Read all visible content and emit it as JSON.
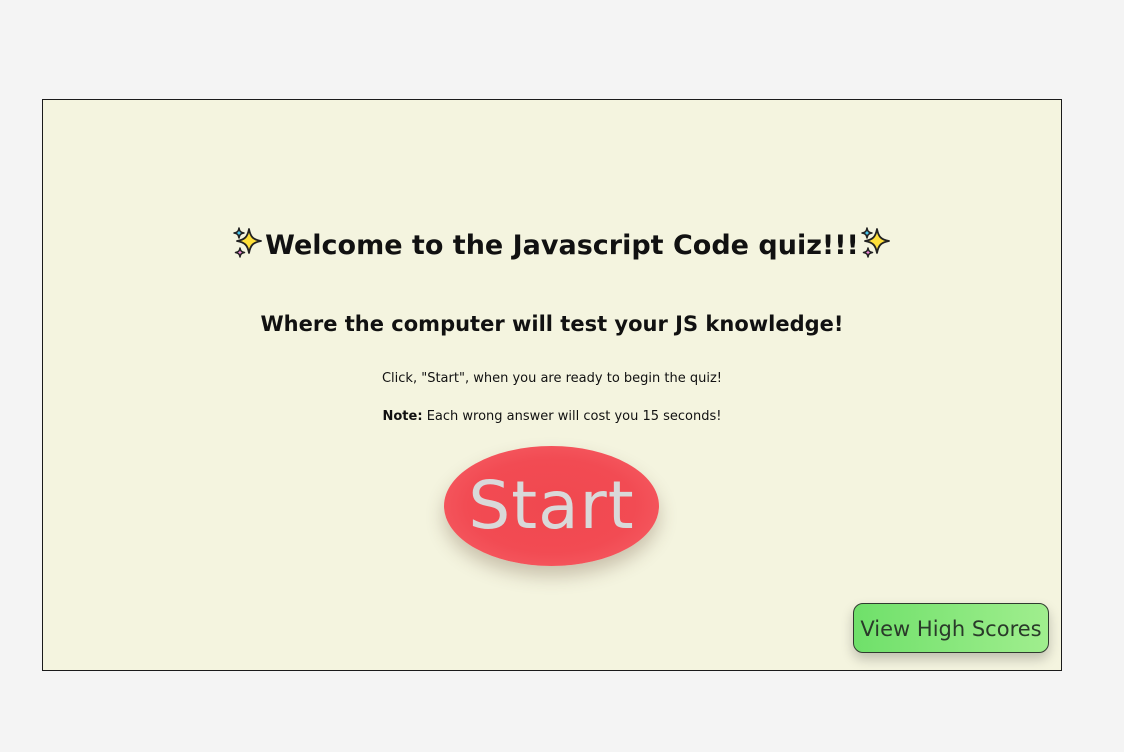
{
  "welcome": {
    "title": "Welcome to the Javascript Code quiz!!!",
    "left_icon": "sparkles-icon",
    "right_icon": "sparkles-icon"
  },
  "subtitle": "Where the computer will test your JS knowledge!",
  "instruction": "Click, \"Start\", when you are ready to begin the quiz!",
  "note": {
    "label": "Note:",
    "text": "Each wrong answer will cost you 15 seconds!"
  },
  "buttons": {
    "start_label": "Start",
    "high_scores_label": "View High Scores"
  },
  "colors": {
    "panel_background": "#f4f4df",
    "start_button": "#f24b53",
    "high_scores_button": "#8be87c"
  }
}
